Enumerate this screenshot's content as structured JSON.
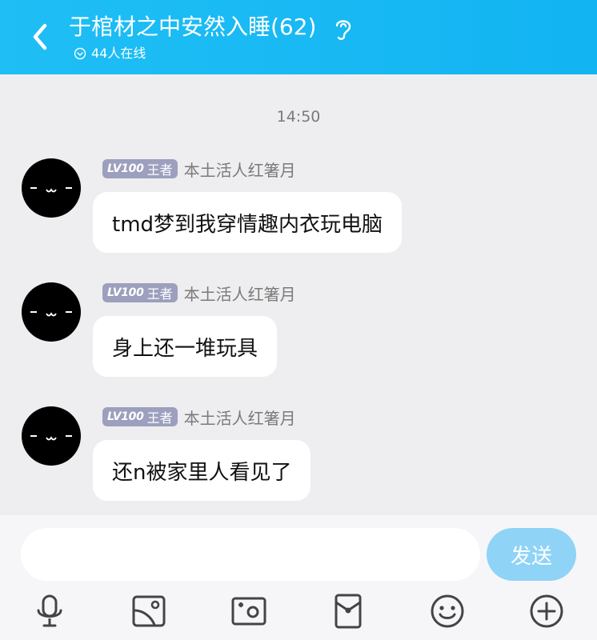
{
  "header": {
    "title": "于棺材之中安然入睡(62)",
    "online": "44人在线",
    "background": "#14b6f3"
  },
  "chat": {
    "timestamp": "14:50",
    "messages": [
      {
        "level": "LV100",
        "rank": "王者",
        "sender": "本土活人红箸月",
        "text": "tmd梦到我穿情趣内衣玩电脑"
      },
      {
        "level": "LV100",
        "rank": "王者",
        "sender": "本土活人红箸月",
        "text": "身上还一堆玩具"
      },
      {
        "level": "LV100",
        "rank": "王者",
        "sender": "本土活人红箸月",
        "text": "还n被家里人看见了"
      }
    ]
  },
  "input": {
    "value": "",
    "send_label": "发送"
  },
  "toolbar": {
    "icons": [
      "microphone-icon",
      "image-icon",
      "camera-icon",
      "red-packet-icon",
      "emoji-icon",
      "plus-icon"
    ]
  }
}
